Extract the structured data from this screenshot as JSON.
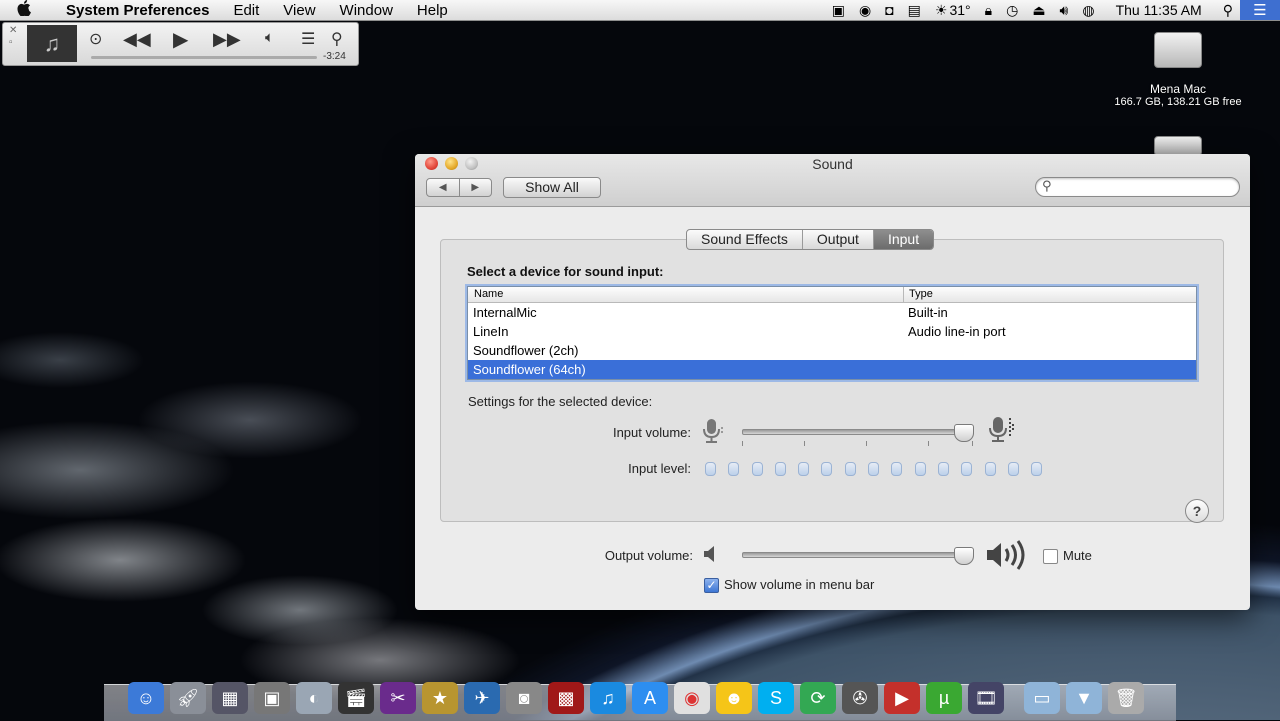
{
  "menubar": {
    "apple": "",
    "app_name": "System Preferences",
    "menus": [
      "Edit",
      "View",
      "Window",
      "Help"
    ],
    "temperature": "31°",
    "clock": "Thu 11:35 AM"
  },
  "miniplayer": {
    "time_remaining": "-3:24",
    "progress": 0.02
  },
  "desktop": {
    "drive_name": "Mena Mac",
    "drive_info": "166.7 GB, 138.21 GB free"
  },
  "window": {
    "title": "Sound",
    "show_all": "Show All",
    "search_placeholder": "",
    "tabs": [
      "Sound Effects",
      "Output",
      "Input"
    ],
    "active_tab": "Input",
    "select_label": "Select a device for sound input:",
    "columns": [
      "Name",
      "Type"
    ],
    "devices": [
      {
        "name": "InternalMic",
        "type": "Built-in"
      },
      {
        "name": "LineIn",
        "type": "Audio line-in port"
      },
      {
        "name": "Soundflower (2ch)",
        "type": ""
      },
      {
        "name": "Soundflower (64ch)",
        "type": ""
      }
    ],
    "selected_device": "Soundflower (64ch)",
    "settings_label": "Settings for the selected device:",
    "input_volume_label": "Input volume:",
    "input_volume": 0.96,
    "input_level_label": "Input level:",
    "input_level_segments": 15,
    "help": "?",
    "output_volume_label": "Output volume:",
    "output_volume": 0.96,
    "mute_label": "Mute",
    "mute_checked": false,
    "show_volume_label": "Show volume in menu bar",
    "show_volume_checked": true
  },
  "colors": {
    "selection": "#3a6fd8",
    "active_tab": "#7c7c7c"
  }
}
